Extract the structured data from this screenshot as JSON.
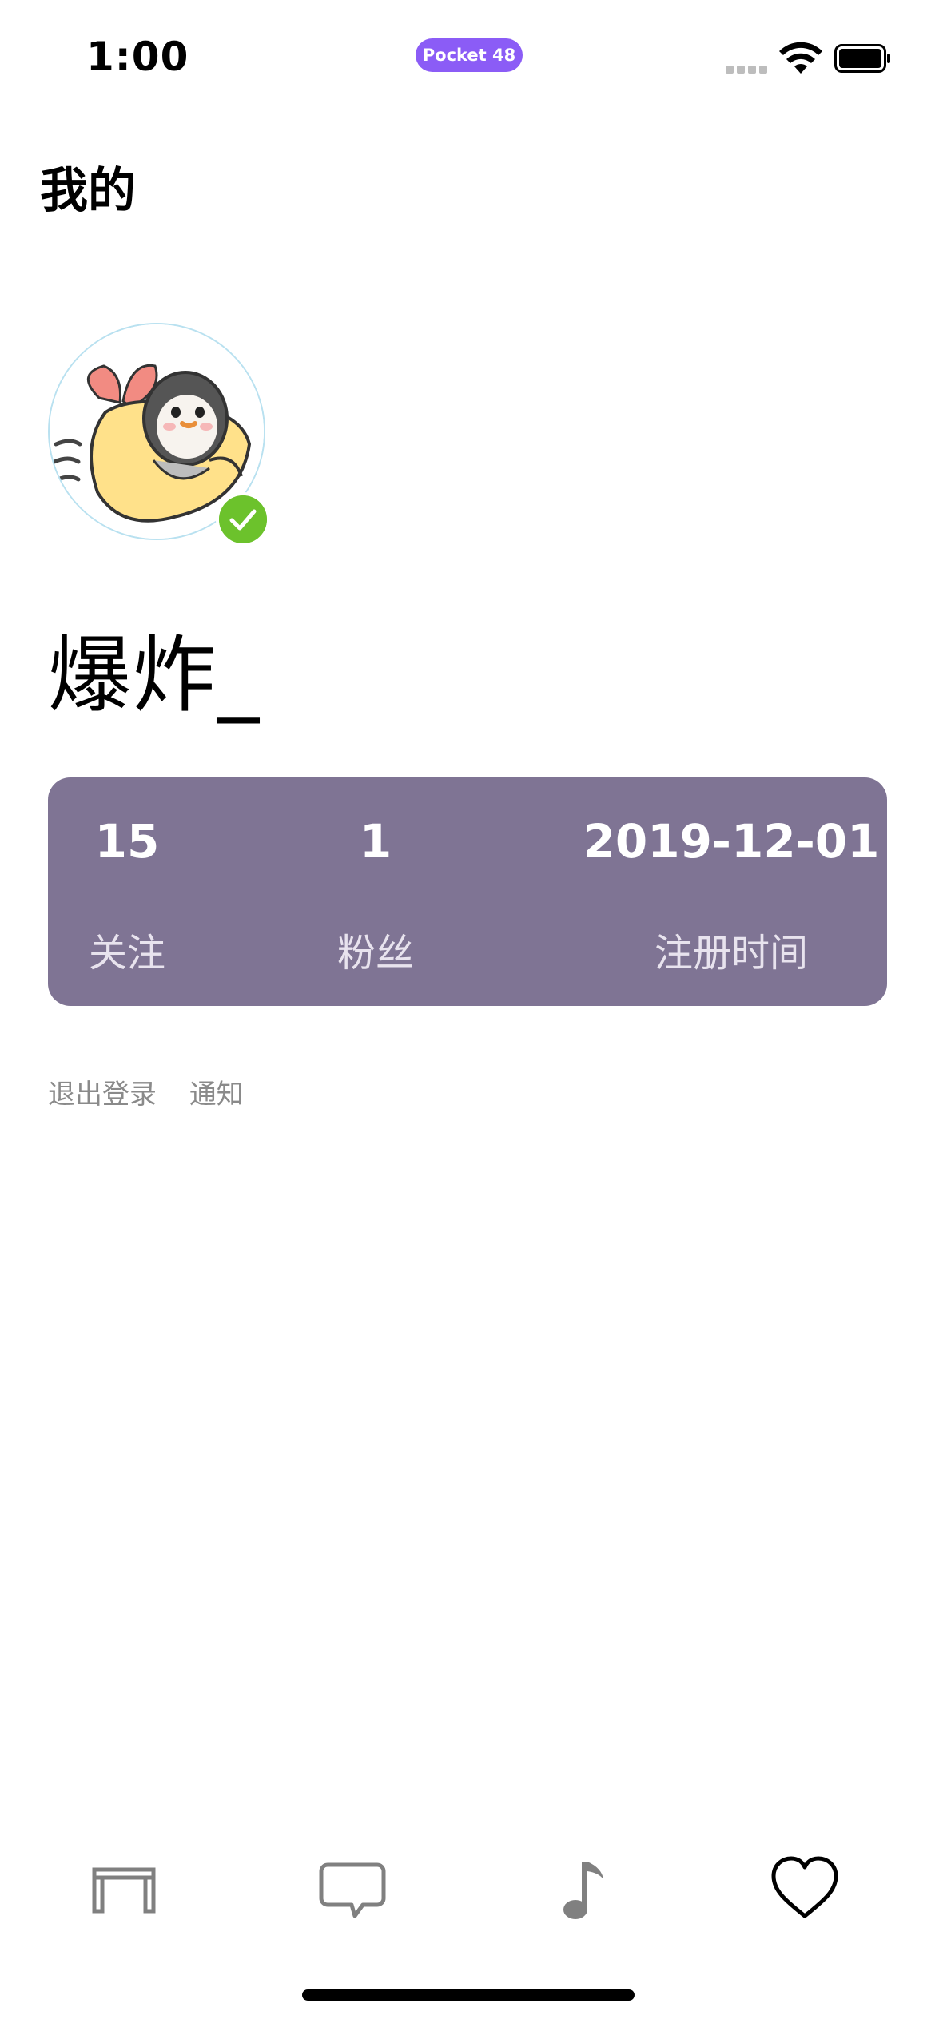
{
  "status_bar": {
    "time": "1:00",
    "app_pill": "Pocket 48"
  },
  "header": {
    "title": "我的"
  },
  "profile": {
    "username": "爆炸_",
    "avatar": "penguin-avatar",
    "verified_color": "#6cc22c"
  },
  "stats": {
    "background": "#7f7494",
    "items": [
      {
        "value": "15",
        "label": "关注"
      },
      {
        "value": "1",
        "label": "粉丝"
      },
      {
        "value": "2019-12-01",
        "label": "注册时间"
      }
    ]
  },
  "links": {
    "logout": "退出登录",
    "notify": "通知"
  },
  "tab_bar": {
    "items": [
      {
        "icon": "table-icon"
      },
      {
        "icon": "chat-bubble-icon"
      },
      {
        "icon": "music-note-icon"
      },
      {
        "icon": "heart-icon"
      }
    ]
  }
}
